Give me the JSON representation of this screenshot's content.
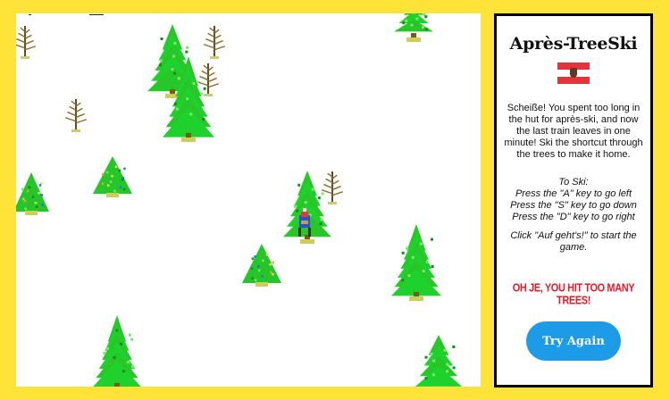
{
  "panel": {
    "title": "Après-TreeSki",
    "flag": "austria-flag",
    "intro": "Scheiße! You spent too long in the hut for après-ski, and now the last train leaves in one minute! Ski the shortcut through the trees to make it home.",
    "instructions_heading": "To Ski:",
    "instructions": [
      "Press the \"A\" key to go left",
      "Press the \"S\" key to go down",
      "Press the \"D\" key to go right"
    ],
    "start_note": "Click \"Auf geht's!\" to start the game.",
    "game_over": "OH JE, YOU HIT TOO MANY TREES!",
    "try_again_label": "Try Again"
  },
  "colors": {
    "border": "#ffe338",
    "pine": "#22cc22",
    "button": "#1e9be6",
    "alert": "#e51c2a",
    "flag_red": "#e4333a"
  },
  "game": {
    "skier": "skier-sprite",
    "hazards": "pine-tree, bare-tree"
  }
}
